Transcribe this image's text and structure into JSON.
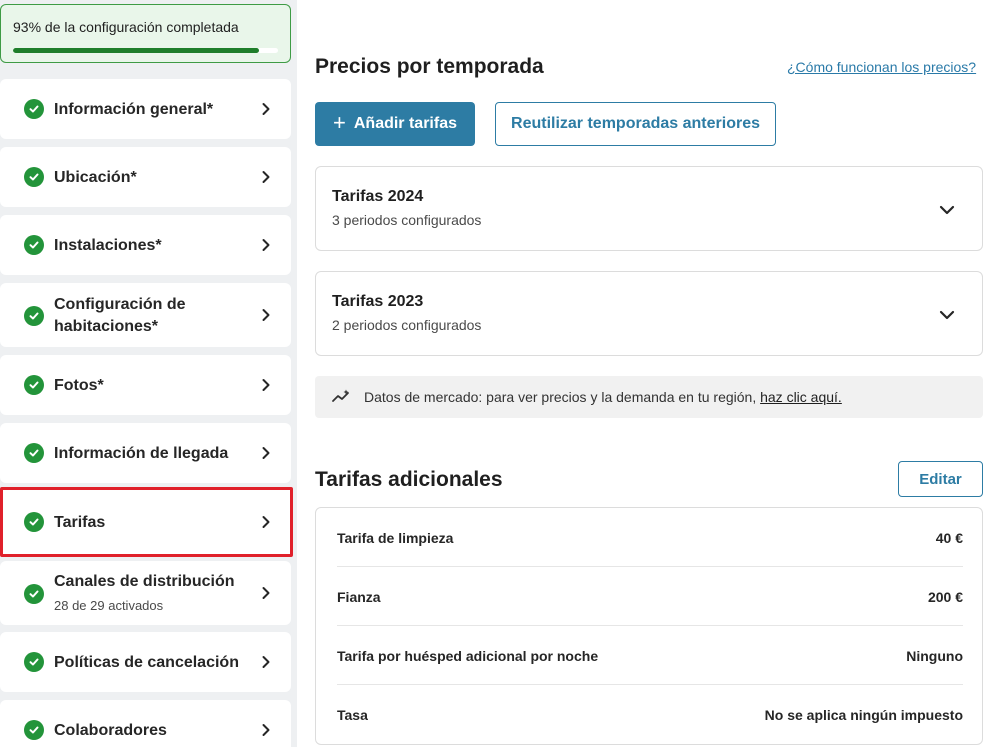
{
  "sidebar": {
    "progress": {
      "label": "93% de la configuración completada",
      "fraction": 0.93
    },
    "items": [
      {
        "label": "Información general*",
        "sub": ""
      },
      {
        "label": "Ubicación*",
        "sub": ""
      },
      {
        "label": "Instalaciones*",
        "sub": ""
      },
      {
        "label": "Configuración de",
        "label2": "habitaciones*",
        "sub": ""
      },
      {
        "label": "Fotos*",
        "sub": ""
      },
      {
        "label": "Información de llegada",
        "sub": ""
      },
      {
        "label": "Tarifas",
        "sub": "",
        "selected": true
      },
      {
        "label": "Canales de distribución",
        "sub": "28 de 29 activados"
      },
      {
        "label": "Políticas de cancelación",
        "sub": ""
      },
      {
        "label": "Colaboradores",
        "sub": ""
      }
    ]
  },
  "pricing": {
    "title": "Precios por temporada",
    "help_link": "¿Cómo funcionan los precios?",
    "add_button": "Añadir tarifas",
    "reuse_button": "Reutilizar temporadas anteriores",
    "seasons": [
      {
        "title": "Tarifas 2024",
        "sub": "3 periodos configurados"
      },
      {
        "title": "Tarifas 2023",
        "sub": "2 periodos configurados"
      }
    ],
    "market": {
      "text": "Datos de mercado: para ver precios y la demanda en tu región,",
      "link": "haz clic aquí."
    }
  },
  "fees": {
    "title": "Tarifas adicionales",
    "edit_button": "Editar",
    "rows": [
      {
        "label": "Tarifa de limpieza",
        "value": "40 €"
      },
      {
        "label": "Fianza",
        "value": "200 €"
      },
      {
        "label": "Tarifa por huésped adicional por noche",
        "value": "Ninguno"
      },
      {
        "label": "Tasa",
        "value": "No se aplica ningún impuesto"
      }
    ]
  },
  "colors": {
    "accent": "#2d7ca4",
    "success": "#23943a",
    "highlight": "#e0202a"
  }
}
